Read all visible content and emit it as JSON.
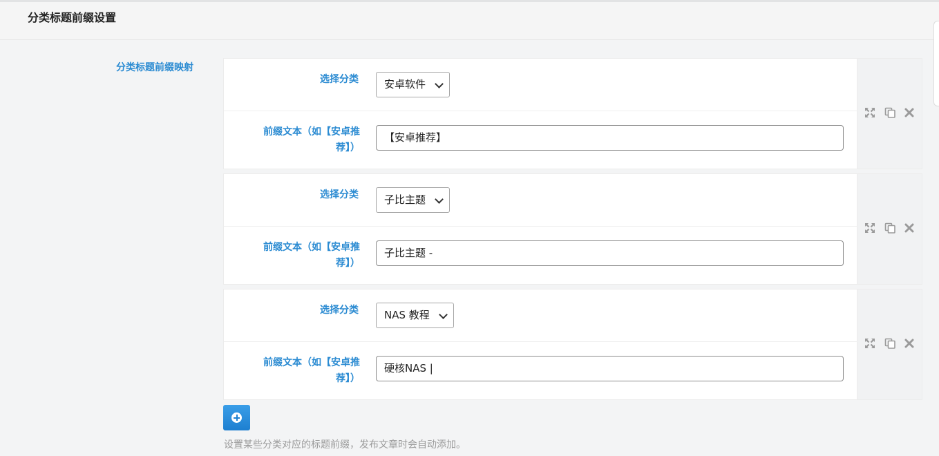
{
  "section": {
    "title": "分类标题前缀设置"
  },
  "field": {
    "label": "分类标题前缀映射",
    "help": "设置某些分类对应的标题前缀，发布文章时会自动添加。"
  },
  "groups": [
    {
      "category_label": "选择分类",
      "category_value": "安卓软件",
      "prefix_label_line1": "前缀文本（如【安卓推",
      "prefix_label_line2": "荐】）",
      "prefix_value": "【安卓推荐】"
    },
    {
      "category_label": "选择分类",
      "category_value": "子比主题",
      "prefix_label_line1": "前缀文本（如【安卓推",
      "prefix_label_line2": "荐】）",
      "prefix_value": "子比主题 -"
    },
    {
      "category_label": "选择分类",
      "category_value": "NAS 教程",
      "prefix_label_line1": "前缀文本（如【安卓推",
      "prefix_label_line2": "荐】）",
      "prefix_value": "硬核NAS |"
    }
  ],
  "icons": {
    "expand": "expand-icon",
    "copy": "copy-icon",
    "close": "close-icon",
    "add": "plus-circle-icon"
  },
  "colors": {
    "accent": "#2b8bd2",
    "button": "#1d7fd0",
    "icon": "#9a9a9a"
  }
}
